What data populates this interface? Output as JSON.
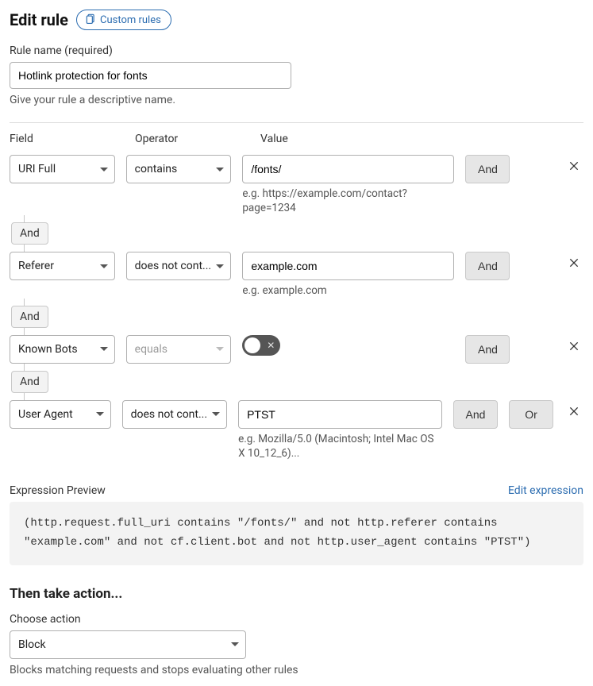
{
  "header": {
    "title": "Edit rule",
    "custom_rules_label": "Custom rules"
  },
  "rule_name": {
    "label": "Rule name (required)",
    "value": "Hotlink protection for fonts",
    "hint": "Give your rule a descriptive name."
  },
  "columns": {
    "field": "Field",
    "operator": "Operator",
    "value": "Value"
  },
  "rows": [
    {
      "field": "URI Full",
      "operator": "contains",
      "value": "/fonts/",
      "hint": "e.g. https://example.com/contact?page=1234",
      "and": "And",
      "join_after": "And"
    },
    {
      "field": "Referer",
      "operator": "does not cont...",
      "value": "example.com",
      "hint": "e.g. example.com",
      "and": "And",
      "join_after": "And"
    },
    {
      "field": "Known Bots",
      "operator": "equals",
      "operator_disabled": true,
      "toggle": false,
      "and": "And",
      "join_after": "And"
    },
    {
      "field": "User Agent",
      "operator": "does not cont...",
      "value": "PTST",
      "hint": "e.g. Mozilla/5.0 (Macintosh; Intel Mac OS X 10_12_6)...",
      "and": "And",
      "or": "Or"
    }
  ],
  "preview": {
    "label": "Expression Preview",
    "edit_label": "Edit expression",
    "expression": "(http.request.full_uri contains \"/fonts/\" and not http.referer contains \"example.com\" and not cf.client.bot and not http.user_agent contains \"PTST\")"
  },
  "action": {
    "heading": "Then take action...",
    "label": "Choose action",
    "value": "Block",
    "hint": "Blocks matching requests and stops evaluating other rules"
  }
}
